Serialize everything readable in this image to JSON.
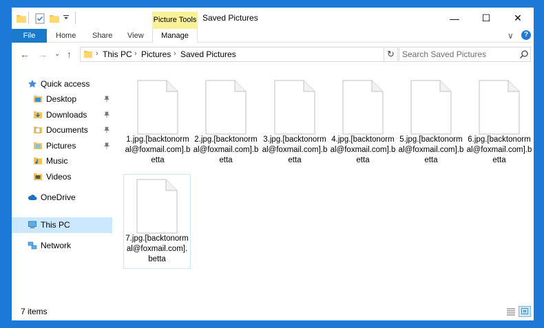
{
  "window": {
    "title": "Saved Pictures",
    "context_tab": "Picture Tools",
    "controls": {
      "minimize": "—",
      "maximize": "☐",
      "close": "✕"
    }
  },
  "ribbon": {
    "file": "File",
    "tabs": [
      "Home",
      "Share",
      "View"
    ],
    "manage": "Manage",
    "collapse": "∨",
    "help": "?"
  },
  "nav": {
    "back": "←",
    "forward": "→",
    "recent": "⌄",
    "up": "↑"
  },
  "address": {
    "crumbs": [
      "This PC",
      "Pictures",
      "Saved Pictures"
    ],
    "separator": "›",
    "dropdown": "⌄",
    "refresh": "↻"
  },
  "search": {
    "placeholder": "Search Saved Pictures"
  },
  "sidebar": {
    "quick_access": "Quick access",
    "items": [
      {
        "label": "Desktop",
        "pinned": true
      },
      {
        "label": "Downloads",
        "pinned": true
      },
      {
        "label": "Documents",
        "pinned": true
      },
      {
        "label": "Pictures",
        "pinned": true
      },
      {
        "label": "Music",
        "pinned": false
      },
      {
        "label": "Videos",
        "pinned": false
      }
    ],
    "onedrive": "OneDrive",
    "thispc": "This PC",
    "network": "Network"
  },
  "files": [
    "1.jpg.[backtonormal@foxmail.com].betta",
    "2.jpg.[backtonormal@foxmail.com].betta",
    "3.jpg.[backtonormal@foxmail.com].betta",
    "4.jpg.[backtonormal@foxmail.com].betta",
    "5.jpg.[backtonormal@foxmail.com].betta",
    "6.jpg.[backtonormal@foxmail.com].betta",
    "7.jpg.[backtonormal@foxmail.com].betta"
  ],
  "status": {
    "count": "7 items"
  },
  "colors": {
    "file_tab": "#1979ca",
    "context_tab": "#fbf09a",
    "selection": "#cce8ff",
    "frame": "#1e78d7"
  }
}
